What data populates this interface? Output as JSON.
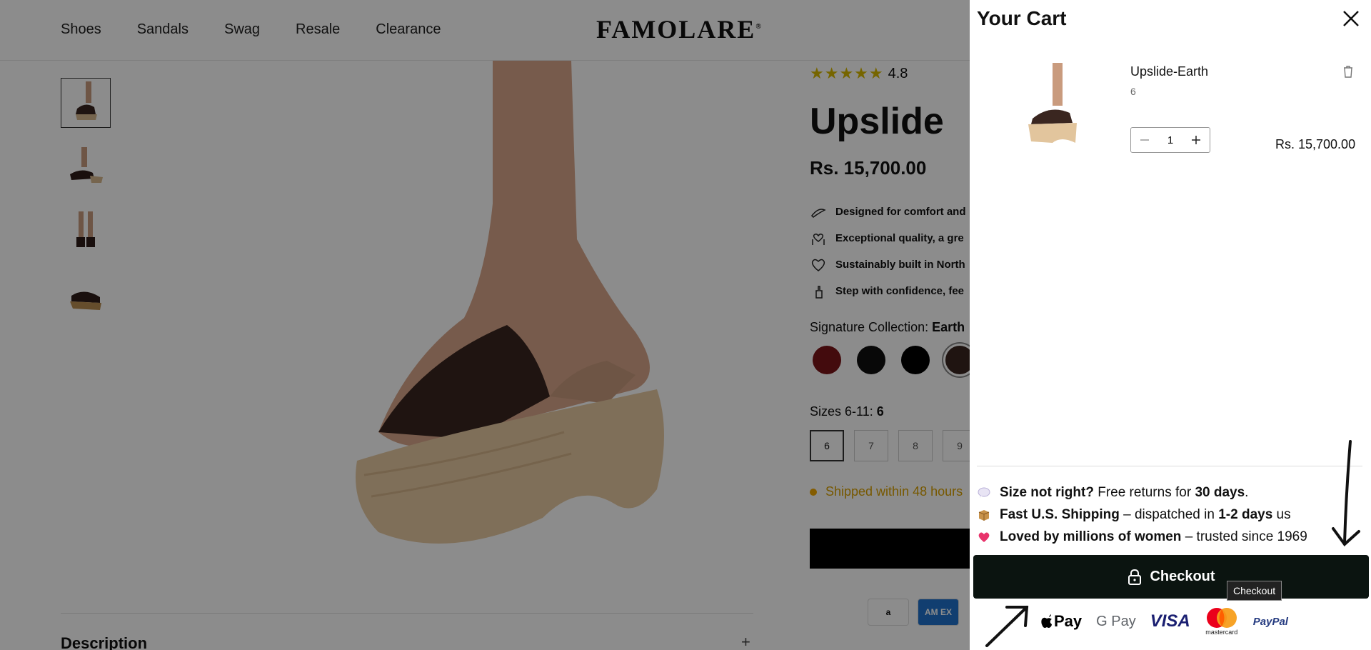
{
  "header": {
    "nav": [
      "Shoes",
      "Sandals",
      "Swag",
      "Resale",
      "Clearance"
    ],
    "logo": "FAMOLARE",
    "logo_mark": "®"
  },
  "product": {
    "rating": "4.8",
    "title": "Upslide",
    "price": "Rs. 15,700.00",
    "features": [
      "Designed for comfort and",
      "Exceptional quality, a gre",
      "Sustainably built in North",
      "Step with confidence, fee"
    ],
    "collection_label": "Signature Collection:",
    "collection_value": "Earth",
    "swatches": [
      "#7a1418",
      "#0f0f0f",
      "#000000",
      "#3a2620"
    ],
    "sizes_label": "Sizes 6-11:",
    "sizes_selected": "6",
    "sizes": [
      "6",
      "7",
      "8",
      "9"
    ],
    "shipped": "Shipped within 48 hours",
    "pay_mini": [
      "a",
      "AM EX"
    ],
    "description_label": "Description",
    "description_toggle": "+"
  },
  "cart": {
    "title": "Your Cart",
    "item": {
      "name": "Upslide-Earth",
      "size": "6",
      "qty": "1",
      "price": "Rs. 15,700.00"
    },
    "perks": [
      {
        "icon": "speech-bubble-icon",
        "bold": "Size not right?",
        "text": " Free returns for ",
        "bold2": "30 days",
        "text2": "."
      },
      {
        "icon": "package-icon",
        "bold": "Fast U.S. Shipping",
        "text": " – dispatched in ",
        "bold2": "1-2 days",
        "text2": " us"
      },
      {
        "icon": "heart-icon",
        "bold": "Loved by millions of women",
        "text": " – trusted since 1969",
        "bold2": "",
        "text2": ""
      }
    ],
    "checkout_label": "Checkout",
    "tooltip": "Checkout",
    "payments": [
      "Pay",
      "G Pay",
      "VISA",
      "mastercard",
      "PayPal"
    ]
  },
  "colors": {
    "accent": "#0b1410",
    "star": "#d8b900",
    "shipped": "#d9a000"
  }
}
